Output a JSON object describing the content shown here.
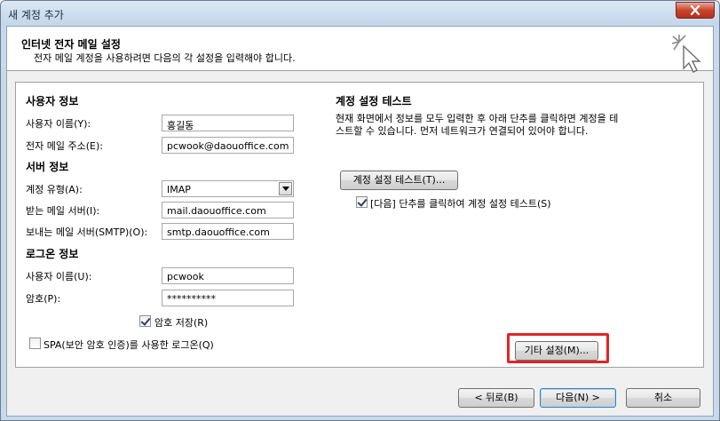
{
  "window": {
    "title": "새 계정 추가"
  },
  "header": {
    "title": "인터넷 전자 메일 설정",
    "subtitle": "전자 메일 계정을 사용하려면 다음의 각 설정을 입력해야 합니다."
  },
  "user_info": {
    "section": "사용자 정보",
    "name_label": "사용자 이름(Y):",
    "name_value": "홍길동",
    "email_label": "전자 메일 주소(E):",
    "email_value": "pcwook@daouoffice.com"
  },
  "server_info": {
    "section": "서버 정보",
    "account_type_label": "계정 유형(A):",
    "account_type_value": "IMAP",
    "incoming_label": "받는 메일 서버(I):",
    "incoming_value": "mail.daouoffice.com",
    "outgoing_label": "보내는 메일 서버(SMTP)(O):",
    "outgoing_value": "smtp.daouoffice.com"
  },
  "logon_info": {
    "section": "로그온 정보",
    "user_label": "사용자 이름(U):",
    "user_value": "pcwook",
    "password_label": "암호(P):",
    "password_value": "**********",
    "remember_password": "암호 저장(R)",
    "spa": "SPA(보안 암호 인증)를 사용한 로그온(Q)"
  },
  "test": {
    "section": "계정 설정 테스트",
    "description": "현재 화면에서 정보를 모두 입력한 후 아래 단추를 클릭하면 계정을 테스트할 수 있습니다. 먼저 네트워크가 연결되어 있어야 합니다.",
    "test_button": "계정 설정 테스트(T)...",
    "auto_test_checkbox": "[다음] 단추를 클릭하여 계정 설정 테스트(S)"
  },
  "more_settings": "기타 설정(M)...",
  "footer": {
    "back": "< 뒤로(B)",
    "next": "다음(N) >",
    "cancel": "취소"
  }
}
